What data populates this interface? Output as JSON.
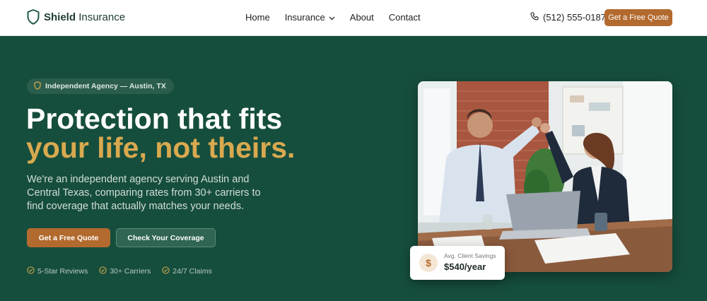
{
  "nav": {
    "brand_bold": "Shield",
    "brand_rest": "Insurance",
    "links": [
      "Home",
      "Insurance",
      "About",
      "Contact"
    ],
    "phone": "(512) 555-0187",
    "cta": "Get a Free Quote"
  },
  "hero": {
    "badge": "Independent Agency — Austin, TX",
    "headline_line1": "Protection that fits",
    "headline_line2": "your life, not theirs.",
    "description": "We're an independent agency serving Austin and Central Texas, comparing rates from 30+ carriers to find coverage that actually matches your needs.",
    "primary_button": "Get a Free Quote",
    "secondary_button": "Check Your Coverage",
    "trust": [
      "5-Star Reviews",
      "30+ Carriers",
      "24/7 Claims"
    ]
  },
  "savings_card": {
    "icon_glyph": "$",
    "label": "Avg. Client Savings",
    "value": "$540/year"
  },
  "colors": {
    "hero_bg": "#164e3d",
    "accent": "#b36a2e",
    "headline_highlight": "#d9a94f"
  },
  "icons": [
    "shield-icon",
    "chevron-down-icon",
    "phone-icon",
    "check-circle-icon",
    "dollar-icon"
  ]
}
